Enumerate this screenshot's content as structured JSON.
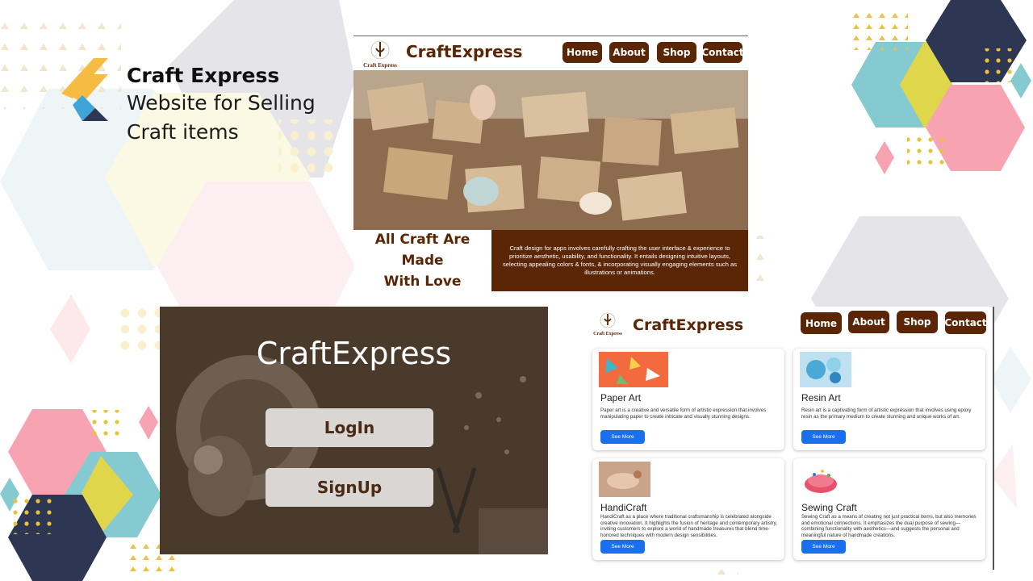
{
  "colors": {
    "brand_brown": "#5a2606",
    "button_blue": "#1a6ef0",
    "hex_navy": "#2d3754",
    "hex_pink": "#f7a3b2",
    "hex_teal": "#86cad1",
    "hex_yellow": "#dfd64b"
  },
  "title": {
    "line1": "Craft Express",
    "line2": "Website for Selling",
    "line3": "Craft items"
  },
  "home_page": {
    "brand": "CraftExpress",
    "logo_text": "Craft Express",
    "nav": [
      "Home",
      "About",
      "Shop",
      "Contact"
    ],
    "heading_line1": "All Craft Are Made",
    "heading_line2": "With Love",
    "description": "Craft design for apps involves carefully crafting the user interface & experience to prioritize aesthetic, usability, and functionality. It entails designing intuitive layouts, selecting appealing colors & fonts, & incorporating visually engaging elements such as illustrations or animations."
  },
  "login_page": {
    "brand": "CraftExpress",
    "login_label": "LogIn",
    "signup_label": "SignUp"
  },
  "products_page": {
    "brand": "CraftExpress",
    "logo_text": "Craft Express",
    "nav": [
      "Home",
      "About",
      "Shop",
      "Contact"
    ],
    "see_more_label": "See More",
    "cards": [
      {
        "title": "Paper Art",
        "desc": "Paper art is a creative and versatile form of artistic expression that involves manipulating paper to create intricate and visually stunning designs."
      },
      {
        "title": "Resin Art",
        "desc": "Resin art is a captivating form of artistic expression that involves using epoxy resin as the primary medium to create stunning and unique works of art."
      },
      {
        "title": "HandiCraft",
        "desc": "HandiCraft as a place where traditional craftsmanship is celebrated alongside creative innovation. It highlights the fusion of heritage and contemporary artistry, inviting customers to explore a world of handmade treasures that blend time-honored techniques with modern design sensibilities."
      },
      {
        "title": "Sewing Craft",
        "desc": "Sewing Craft as a means of creating not just practical items, but also memories and emotional connections. It emphasizes the dual purpose of sewing—combining functionality with aesthetics—and suggests the personal and meaningful nature of handmade creations."
      }
    ]
  }
}
